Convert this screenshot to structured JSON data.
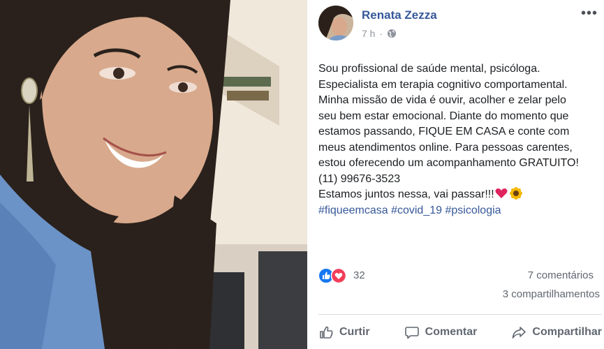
{
  "author": {
    "name": "Renata Zezza",
    "time": "7 h",
    "privacy_icon": "globe-icon"
  },
  "post": {
    "text": "Sou profissional de saúde mental, psicóloga.\nEspecialista em terapia cognitivo comportamental.\nMinha missão de vida é ouvir, acolher e zelar pelo\nseu bem estar emocional. Diante do momento que\nestamos passando, FIQUE EM CASA e conte com\nmeus atendimentos online. Para pessoas carentes,\nestou oferecendo um acompanhamento GRATUITO!\n(11) 99676-3523",
    "closing": "Estamos juntos nessa, vai passar!!!",
    "closing_emojis": [
      "heart-emoji",
      "sunflower-emoji"
    ],
    "hashtags": [
      "#fiqueemcasa",
      "#covid_19",
      "#psicologia"
    ]
  },
  "stats": {
    "reaction_count": "32",
    "comments": "7 comentários",
    "shares": "3 compartilhamentos"
  },
  "actions": {
    "like": "Curtir",
    "comment": "Comentar",
    "share": "Compartilhar"
  },
  "colors": {
    "link": "#365899",
    "text": "#1c1e21",
    "muted": "#606770",
    "like_blue": "#1877f2",
    "love_red": "#f33e58"
  }
}
